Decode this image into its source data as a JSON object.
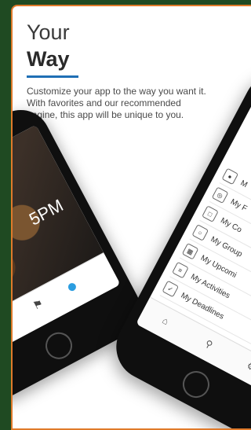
{
  "headline": {
    "line1": "Your",
    "line2": "Way"
  },
  "description": "Customize your app to the way you want it. With favorites and our recommended engine, this app will be unique to you.",
  "left_phone": {
    "clock_text": "5PM",
    "tabbar": {
      "person_icon": "person-icon",
      "bell_icon": "bell-icon",
      "active_dot": "active-tab-dot"
    }
  },
  "right_phone": {
    "menu_items": [
      {
        "label": "M",
        "icon": "person-icon"
      },
      {
        "label": "My F",
        "icon": "target-icon"
      },
      {
        "label": "My Co",
        "icon": "book-icon"
      },
      {
        "label": "My Group",
        "icon": "group-icon"
      },
      {
        "label": "My Upcomi",
        "icon": "calendar-icon"
      },
      {
        "label": "My Activities",
        "icon": "list-icon"
      },
      {
        "label": "My Deadlines",
        "icon": "checklist-icon"
      }
    ],
    "tabbar": {
      "home_icon": "home-icon",
      "search_icon": "search-icon",
      "settings_icon": "settings-icon"
    }
  },
  "colors": {
    "background": "#1f4a22",
    "frame": "#e07a2a",
    "accent": "#1f6fb5",
    "tab_dot": "#2b9de0"
  }
}
